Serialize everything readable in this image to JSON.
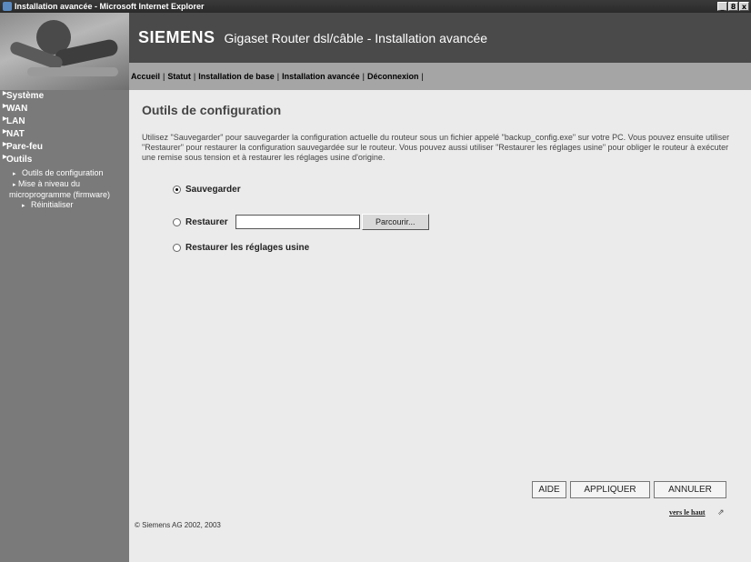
{
  "window": {
    "title": "Installation avancée - Microsoft Internet Explorer",
    "controls": [
      "_",
      "8",
      "x"
    ]
  },
  "header": {
    "brand": "SIEMENS",
    "product": "Gigaset Router dsl/câble  -  Installation avancée"
  },
  "nav": {
    "items": [
      "Accueil",
      "Statut",
      "Installation de base",
      "Installation avancée",
      "Déconnexion"
    ]
  },
  "sidebar": {
    "items": [
      "Système",
      "WAN",
      "LAN",
      "NAT",
      "Pare-feu",
      "Outils"
    ],
    "subitems": [
      "Outils de configuration",
      "Mise à niveau du microprogramme (firmware)",
      "Réinitialiser"
    ]
  },
  "main": {
    "title": "Outils de configuration",
    "description": "Utilisez \"Sauvegarder\" pour sauvegarder la configuration actuelle du routeur sous un fichier appelé \"backup_config.exe\" sur votre PC. Vous pouvez ensuite utiliser \"Restaurer\" pour restaurer la configuration sauvegardée sur le routeur. Vous pouvez aussi utiliser \"Restaurer les réglages usine\" pour obliger le routeur à exécuter une remise sous tension et à restaurer les réglages usine d'origine.",
    "options": {
      "save": "Sauvegarder",
      "restore": "Restaurer",
      "factory": "Restaurer les réglages usine",
      "selected": "save"
    },
    "restore_file_value": "",
    "browse_label": "Parcourir..."
  },
  "actions": {
    "help": "AIDE",
    "apply": "APPLIQUER",
    "cancel": "ANNULER"
  },
  "footer": {
    "top_link": "vers le haut",
    "copyright": "© Siemens AG 2002, 2003"
  },
  "colors": {
    "sidebar_bg": "#7a7a7a",
    "header_bg": "#4a4a4a",
    "nav_bg": "#a5a5a5",
    "content_bg": "#ebebeb"
  },
  "icons": {
    "window": "ie-icon",
    "sidebar_arrow": "triangle-right-icon",
    "sub_bullet": "bullet-icon",
    "top_link": "arrow-up-icon"
  }
}
